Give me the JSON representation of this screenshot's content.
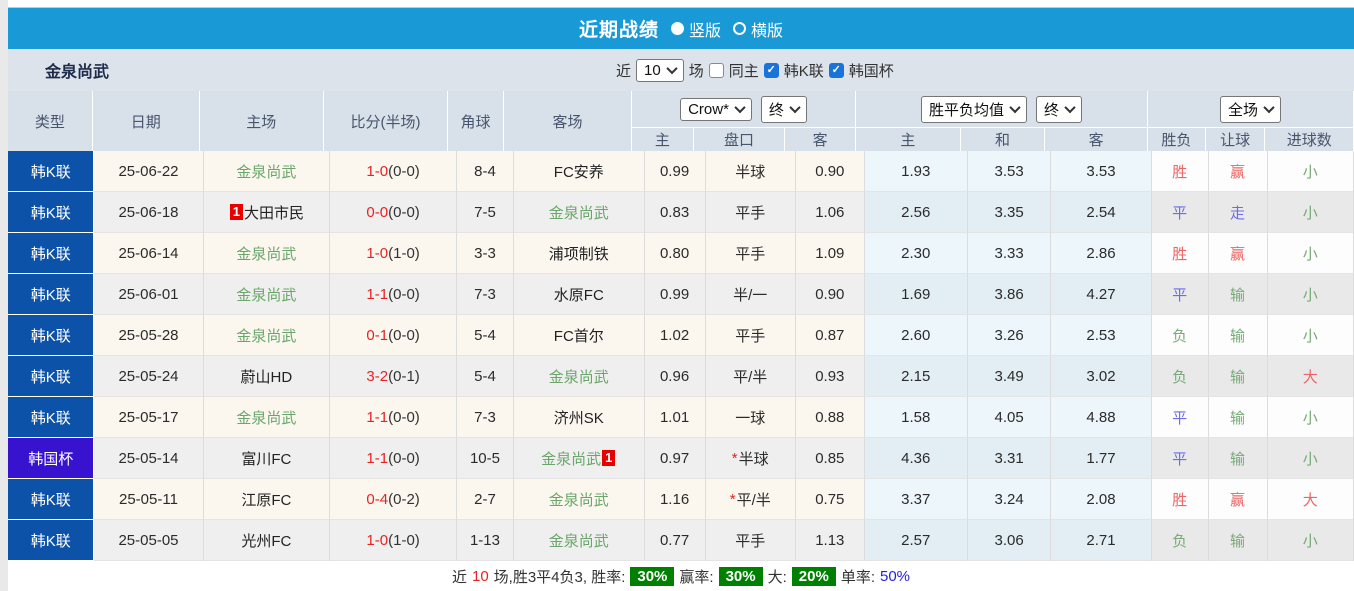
{
  "titlebar": {
    "title": "近期战绩",
    "radios": [
      {
        "label": "竖版",
        "selected": true
      },
      {
        "label": "横版",
        "selected": false
      }
    ]
  },
  "filters": {
    "team": "金泉尚武",
    "near_label": "近",
    "near_value": "10",
    "games_label": "场",
    "checkboxes": [
      {
        "label": "同主",
        "checked": false
      },
      {
        "label": "韩K联",
        "checked": true
      },
      {
        "label": "韩国杯",
        "checked": true
      }
    ]
  },
  "table": {
    "left_headers": [
      "类型",
      "日期",
      "主场",
      "比分(半场)",
      "角球",
      "客场"
    ],
    "groups": [
      {
        "selects": [
          "Crow*",
          "终"
        ],
        "cols": [
          "主",
          "盘口",
          "客"
        ]
      },
      {
        "selects": [
          "胜平负均值",
          "终"
        ],
        "cols": [
          "主",
          "和",
          "客"
        ]
      },
      {
        "selects": [
          "全场"
        ],
        "cols": [
          "胜负",
          "让球",
          "进球数"
        ]
      }
    ],
    "rows": [
      {
        "league": "韩K联",
        "league_type": "kleague",
        "date": "25-06-22",
        "home": "金泉尚武",
        "home_green": true,
        "home_badge": "",
        "score_ft": "1-0",
        "score_ht": "(0-0)",
        "corners": "8-4",
        "away": "FC安养",
        "away_green": false,
        "away_badge": "",
        "odds_home": "0.99",
        "hcp_star": "",
        "hcp": "半球",
        "odds_away": "0.90",
        "avg_home": "1.93",
        "avg_draw": "3.53",
        "avg_away": "3.53",
        "result": "胜",
        "result_color": "red",
        "let": "赢",
        "let_color": "red",
        "goal": "小",
        "goal_color": "green"
      },
      {
        "league": "韩K联",
        "league_type": "kleague",
        "date": "25-06-18",
        "home": "大田市民",
        "home_green": false,
        "home_badge": "1",
        "score_ft": "0-0",
        "score_ht": "(0-0)",
        "corners": "7-5",
        "away": "金泉尚武",
        "away_green": true,
        "away_badge": "",
        "odds_home": "0.83",
        "hcp_star": "",
        "hcp": "平手",
        "odds_away": "1.06",
        "avg_home": "2.56",
        "avg_draw": "3.35",
        "avg_away": "2.54",
        "result": "平",
        "result_color": "blue",
        "let": "走",
        "let_color": "blue",
        "goal": "小",
        "goal_color": "green"
      },
      {
        "league": "韩K联",
        "league_type": "kleague",
        "date": "25-06-14",
        "home": "金泉尚武",
        "home_green": true,
        "home_badge": "",
        "score_ft": "1-0",
        "score_ht": "(1-0)",
        "corners": "3-3",
        "away": "浦项制铁",
        "away_green": false,
        "away_badge": "",
        "odds_home": "0.80",
        "hcp_star": "",
        "hcp": "平手",
        "odds_away": "1.09",
        "avg_home": "2.30",
        "avg_draw": "3.33",
        "avg_away": "2.86",
        "result": "胜",
        "result_color": "red",
        "let": "赢",
        "let_color": "red",
        "goal": "小",
        "goal_color": "green"
      },
      {
        "league": "韩K联",
        "league_type": "kleague",
        "date": "25-06-01",
        "home": "金泉尚武",
        "home_green": true,
        "home_badge": "",
        "score_ft": "1-1",
        "score_ht": "(0-0)",
        "corners": "7-3",
        "away": "水原FC",
        "away_green": false,
        "away_badge": "",
        "odds_home": "0.99",
        "hcp_star": "",
        "hcp": "半/一",
        "odds_away": "0.90",
        "avg_home": "1.69",
        "avg_draw": "3.86",
        "avg_away": "4.27",
        "result": "平",
        "result_color": "blue",
        "let": "输",
        "let_color": "green",
        "goal": "小",
        "goal_color": "green"
      },
      {
        "league": "韩K联",
        "league_type": "kleague",
        "date": "25-05-28",
        "home": "金泉尚武",
        "home_green": true,
        "home_badge": "",
        "score_ft": "0-1",
        "score_ht": "(0-0)",
        "corners": "5-4",
        "away": "FC首尔",
        "away_green": false,
        "away_badge": "",
        "odds_home": "1.02",
        "hcp_star": "",
        "hcp": "平手",
        "odds_away": "0.87",
        "avg_home": "2.60",
        "avg_draw": "3.26",
        "avg_away": "2.53",
        "result": "负",
        "result_color": "green",
        "let": "输",
        "let_color": "green",
        "goal": "小",
        "goal_color": "green"
      },
      {
        "league": "韩K联",
        "league_type": "kleague",
        "date": "25-05-24",
        "home": "蔚山HD",
        "home_green": false,
        "home_badge": "",
        "score_ft": "3-2",
        "score_ht": "(0-1)",
        "corners": "5-4",
        "away": "金泉尚武",
        "away_green": true,
        "away_badge": "",
        "odds_home": "0.96",
        "hcp_star": "",
        "hcp": "平/半",
        "odds_away": "0.93",
        "avg_home": "2.15",
        "avg_draw": "3.49",
        "avg_away": "3.02",
        "result": "负",
        "result_color": "green",
        "let": "输",
        "let_color": "green",
        "goal": "大",
        "goal_color": "red"
      },
      {
        "league": "韩K联",
        "league_type": "kleague",
        "date": "25-05-17",
        "home": "金泉尚武",
        "home_green": true,
        "home_badge": "",
        "score_ft": "1-1",
        "score_ht": "(0-0)",
        "corners": "7-3",
        "away": "济州SK",
        "away_green": false,
        "away_badge": "",
        "odds_home": "1.01",
        "hcp_star": "",
        "hcp": "一球",
        "odds_away": "0.88",
        "avg_home": "1.58",
        "avg_draw": "4.05",
        "avg_away": "4.88",
        "result": "平",
        "result_color": "blue",
        "let": "输",
        "let_color": "green",
        "goal": "小",
        "goal_color": "green"
      },
      {
        "league": "韩国杯",
        "league_type": "cup",
        "date": "25-05-14",
        "home": "富川FC",
        "home_green": false,
        "home_badge": "",
        "score_ft": "1-1",
        "score_ht": "(0-0)",
        "corners": "10-5",
        "away": "金泉尚武",
        "away_green": true,
        "away_badge": "1",
        "odds_home": "0.97",
        "hcp_star": "*",
        "hcp": "半球",
        "odds_away": "0.85",
        "avg_home": "4.36",
        "avg_draw": "3.31",
        "avg_away": "1.77",
        "result": "平",
        "result_color": "blue",
        "let": "输",
        "let_color": "green",
        "goal": "小",
        "goal_color": "green"
      },
      {
        "league": "韩K联",
        "league_type": "kleague",
        "date": "25-05-11",
        "home": "江原FC",
        "home_green": false,
        "home_badge": "",
        "score_ft": "0-4",
        "score_ht": "(0-2)",
        "corners": "2-7",
        "away": "金泉尚武",
        "away_green": true,
        "away_badge": "",
        "odds_home": "1.16",
        "hcp_star": "*",
        "hcp": "平/半",
        "odds_away": "0.75",
        "avg_home": "3.37",
        "avg_draw": "3.24",
        "avg_away": "2.08",
        "result": "胜",
        "result_color": "red",
        "let": "赢",
        "let_color": "red",
        "goal": "大",
        "goal_color": "red"
      },
      {
        "league": "韩K联",
        "league_type": "kleague",
        "date": "25-05-05",
        "home": "光州FC",
        "home_green": false,
        "home_badge": "",
        "score_ft": "1-0",
        "score_ht": "(1-0)",
        "corners": "1-13",
        "away": "金泉尚武",
        "away_green": true,
        "away_badge": "",
        "odds_home": "0.77",
        "hcp_star": "",
        "hcp": "平手",
        "odds_away": "1.13",
        "avg_home": "2.57",
        "avg_draw": "3.06",
        "avg_away": "2.71",
        "result": "负",
        "result_color": "green",
        "let": "输",
        "let_color": "green",
        "goal": "小",
        "goal_color": "green"
      }
    ]
  },
  "footer": {
    "near": "近",
    "count": "10",
    "summary": "场,胜3平4负3, 胜率:",
    "win_rate": "30%",
    "let_label": "赢率:",
    "let_rate": "30%",
    "big_label": "大:",
    "big_rate": "20%",
    "single_label": "单率:",
    "single_rate": "50%"
  },
  "colors": {
    "titlebar": "#1999d5",
    "kleague": "#0b52a8",
    "cup": "#3712cf",
    "win_red": "#ee6363",
    "draw_blue": "#6b6bee",
    "lose_green": "#77aa77",
    "rate_badge_bg": "#008000"
  }
}
